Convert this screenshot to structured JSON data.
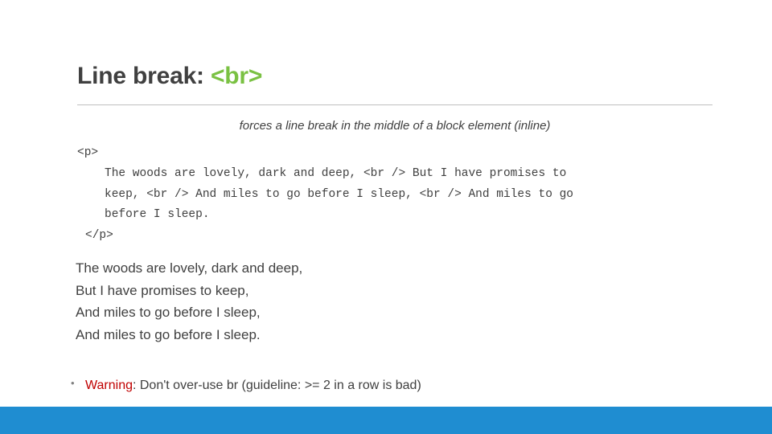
{
  "slide": {
    "title": {
      "prefix": "Line break: ",
      "tag": "<br>"
    },
    "subtitle": "forces a line break in the middle of a block element (inline)",
    "code": {
      "open_tag": "<p>",
      "body_line_1": "The woods are lovely, dark and deep, <br /> But I have promises to",
      "body_line_2": "keep, <br /> And miles to go before I sleep, <br /> And miles to go",
      "body_line_3": "before I sleep.",
      "close_tag": "</p>"
    },
    "poem": [
      "The woods are lovely, dark and deep,",
      "But I have promises to keep,",
      "And miles to go before I sleep,",
      "And miles to go before I sleep."
    ],
    "bullet": {
      "marker": "•",
      "warning_label": "Warning",
      "rest": ": Don't over-use br (guideline: >= 2 in a row is bad)"
    },
    "colors": {
      "tag_green": "#7ac143",
      "warning_red": "#c00000",
      "footer_blue": "#1f8dd1",
      "body_gray": "#404040"
    }
  }
}
